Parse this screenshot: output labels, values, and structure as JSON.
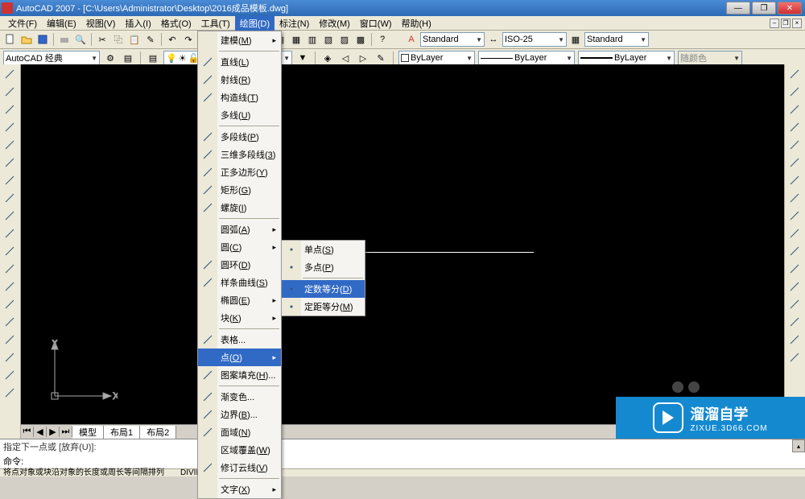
{
  "title": "AutoCAD 2007 - [C:\\Users\\Administrator\\Desktop\\2016成品模板.dwg]",
  "menubar": {
    "items": [
      "文件(F)",
      "编辑(E)",
      "视图(V)",
      "插入(I)",
      "格式(O)",
      "工具(T)",
      "绘图(D)",
      "标注(N)",
      "修改(M)",
      "窗口(W)",
      "帮助(H)"
    ],
    "active_index": 6
  },
  "toolbar1": {
    "textstyle": "Standard",
    "dimstyle": "ISO-25",
    "tablestyle": "Standard"
  },
  "toolbar2": {
    "workspace": "AutoCAD 经典",
    "layer_color_label": "ByLayer",
    "linetype_label": "ByLayer",
    "lineweight_label": "ByLayer",
    "color_label": "随颜色"
  },
  "draw_menu": {
    "items": [
      {
        "label": "建模(M)",
        "arrow": true
      },
      {
        "sep": true
      },
      {
        "label": "直线(L)",
        "icon": "line"
      },
      {
        "label": "射线(R)",
        "icon": "ray"
      },
      {
        "label": "构造线(T)",
        "icon": "xline"
      },
      {
        "label": "多线(U)"
      },
      {
        "sep": true
      },
      {
        "label": "多段线(P)",
        "icon": "pline"
      },
      {
        "label": "三维多段线(3)",
        "icon": "3dpoly"
      },
      {
        "label": "正多边形(Y)",
        "icon": "polygon"
      },
      {
        "label": "矩形(G)",
        "icon": "rect"
      },
      {
        "label": "螺旋(I)",
        "icon": "helix"
      },
      {
        "sep": true
      },
      {
        "label": "圆弧(A)",
        "arrow": true
      },
      {
        "label": "圆(C)",
        "arrow": true
      },
      {
        "label": "圆环(D)",
        "icon": "donut"
      },
      {
        "label": "样条曲线(S)",
        "icon": "spline"
      },
      {
        "label": "椭圆(E)",
        "arrow": true
      },
      {
        "label": "块(K)",
        "arrow": true
      },
      {
        "sep": true
      },
      {
        "label": "表格...",
        "icon": "table"
      },
      {
        "label": "点(O)",
        "arrow": true,
        "hl": true
      },
      {
        "label": "图案填充(H)...",
        "icon": "hatch"
      },
      {
        "sep": true
      },
      {
        "label": "渐变色...",
        "icon": "grad"
      },
      {
        "label": "边界(B)...",
        "icon": "bound"
      },
      {
        "label": "面域(N)",
        "icon": "region"
      },
      {
        "label": "区域覆盖(W)"
      },
      {
        "label": "修订云线(V)",
        "icon": "revcloud"
      },
      {
        "sep": true
      },
      {
        "label": "文字(X)",
        "arrow": true
      }
    ]
  },
  "point_submenu": {
    "items": [
      {
        "label": "单点(S)",
        "icon": "pt1"
      },
      {
        "label": "多点(P)",
        "icon": "pt2"
      },
      {
        "sep": true
      },
      {
        "label": "定数等分(D)",
        "icon": "div",
        "hl": true
      },
      {
        "label": "定距等分(M)",
        "icon": "meas"
      }
    ]
  },
  "layout_tabs": {
    "tabs": [
      "模型",
      "布局1",
      "布局2"
    ]
  },
  "command": {
    "history": "指定下一点或 [放弃(U)]:",
    "prompt": "命令:"
  },
  "statusbar": {
    "left": "将点对象或块沿对象的长度或周长等间隔排列",
    "cmd": "DIVIDE"
  },
  "ucs_labels": {
    "x": "X",
    "y": "Y"
  },
  "left_tool_names": [
    "line",
    "xline",
    "pline",
    "polygon",
    "rect",
    "arc",
    "circle",
    "revcloud",
    "spline",
    "ellipse",
    "ellipse-arc",
    "insert",
    "make-block",
    "point",
    "hatch",
    "gradient",
    "region",
    "table",
    "mtext"
  ],
  "right_tool_names": [
    "erase",
    "copy",
    "mirror",
    "offset",
    "array",
    "move",
    "rotate",
    "scale",
    "stretch",
    "trim",
    "extend",
    "break-at",
    "break",
    "join",
    "chamfer",
    "fillet",
    "explode"
  ],
  "watermark": {
    "title": "溜溜自学",
    "url": "ZIXUE.3D66.COM"
  }
}
